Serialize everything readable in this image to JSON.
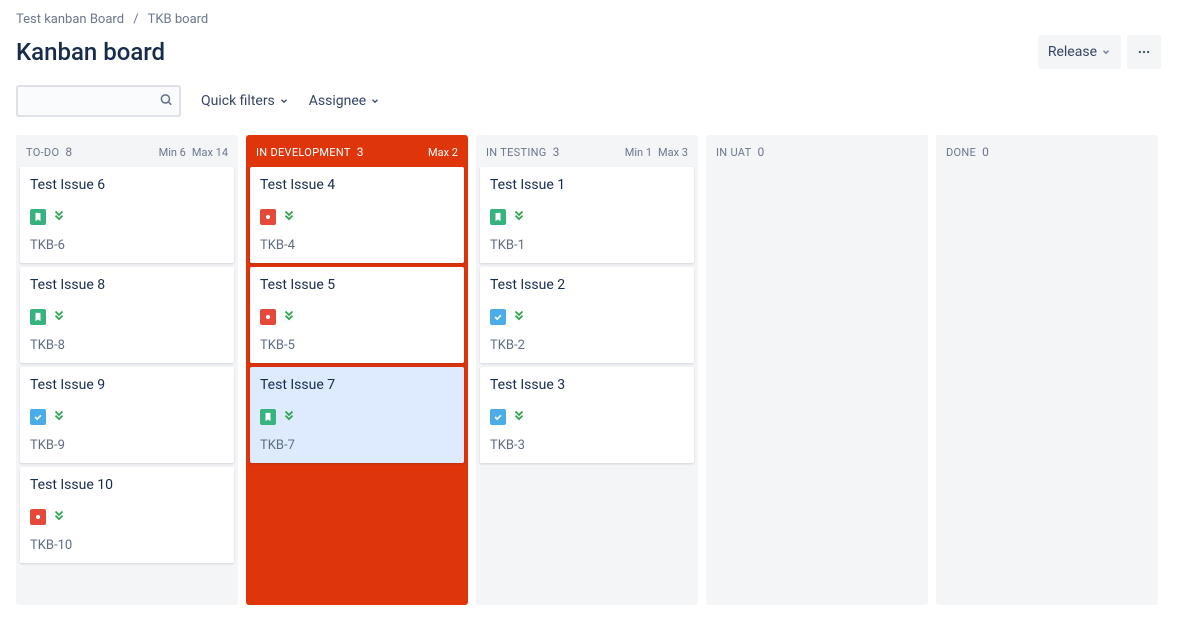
{
  "breadcrumb": {
    "parent": "Test kanban Board",
    "current": "TKB board"
  },
  "page_title": "Kanban board",
  "header": {
    "release_label": "Release"
  },
  "filters": {
    "quick_filters_label": "Quick filters",
    "assignee_label": "Assignee",
    "search_placeholder": ""
  },
  "columns": [
    {
      "title": "TO-DO",
      "count": 8,
      "min": "Min 6",
      "max": "Max 14",
      "warn": false,
      "cards": [
        {
          "title": "Test Issue 6",
          "type": "story",
          "priority": "medium",
          "key": "TKB-6",
          "selected": false
        },
        {
          "title": "Test Issue 8",
          "type": "story",
          "priority": "medium",
          "key": "TKB-8",
          "selected": false
        },
        {
          "title": "Test Issue 9",
          "type": "task",
          "priority": "medium",
          "key": "TKB-9",
          "selected": false
        },
        {
          "title": "Test Issue 10",
          "type": "bug",
          "priority": "medium",
          "key": "TKB-10",
          "selected": false
        }
      ]
    },
    {
      "title": "IN DEVELOPMENT",
      "count": 3,
      "min": "",
      "max": "Max 2",
      "warn": true,
      "cards": [
        {
          "title": "Test Issue 4",
          "type": "bug",
          "priority": "medium",
          "key": "TKB-4",
          "selected": false
        },
        {
          "title": "Test Issue 5",
          "type": "bug",
          "priority": "medium",
          "key": "TKB-5",
          "selected": false
        },
        {
          "title": "Test Issue 7",
          "type": "story",
          "priority": "medium",
          "key": "TKB-7",
          "selected": true
        }
      ]
    },
    {
      "title": "IN TESTING",
      "count": 3,
      "min": "Min 1",
      "max": "Max 3",
      "warn": false,
      "cards": [
        {
          "title": "Test Issue 1",
          "type": "story",
          "priority": "medium",
          "key": "TKB-1",
          "selected": false
        },
        {
          "title": "Test Issue 2",
          "type": "task",
          "priority": "medium",
          "key": "TKB-2",
          "selected": false
        },
        {
          "title": "Test Issue 3",
          "type": "task",
          "priority": "medium",
          "key": "TKB-3",
          "selected": false
        }
      ]
    },
    {
      "title": "IN UAT",
      "count": 0,
      "min": "",
      "max": "",
      "warn": false,
      "cards": []
    },
    {
      "title": "DONE",
      "count": 0,
      "min": "",
      "max": "",
      "warn": false,
      "cards": []
    }
  ],
  "icons": {
    "story": "bookmark-icon",
    "bug": "bug-icon",
    "task": "check-icon"
  }
}
